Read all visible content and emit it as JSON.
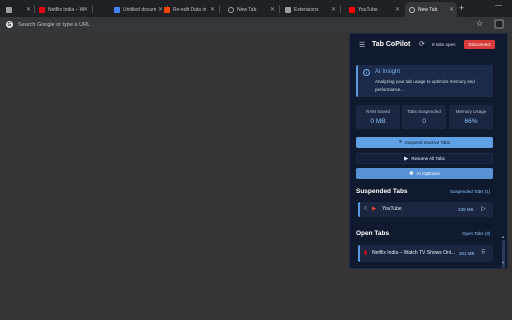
{
  "browser": {
    "tabs": [
      {
        "title": "",
        "favicon": "generic-icon",
        "active": false
      },
      {
        "title": "Netflix India – W",
        "favicon": "netflix-icon",
        "active": false
      },
      {
        "title": "Untitled docum",
        "favicon": "docs-icon",
        "active": false
      },
      {
        "title": "Re-edit Data in",
        "favicon": "reddit-icon",
        "active": false
      },
      {
        "title": "New Tab",
        "favicon": "chrome-icon",
        "active": false
      },
      {
        "title": "Extensions",
        "favicon": "puzzle-icon",
        "active": false
      },
      {
        "title": "YouTube",
        "favicon": "youtube-icon",
        "active": false
      },
      {
        "title": "New Tab",
        "favicon": "chrome-icon",
        "active": true
      }
    ],
    "omnibox_placeholder": "Search Google or type a URL"
  },
  "popup": {
    "title": "Tab CoPilot",
    "tabs_open": "8 tabs open",
    "disconnect_label": "Disconnect",
    "insight": {
      "title": "AI Insight",
      "text": "Analyzing your tab usage to optimize memory and performance..."
    },
    "stats": [
      {
        "label": "RAM Saved",
        "value": "0 MB"
      },
      {
        "label": "Tabs Suspended",
        "value": "0"
      },
      {
        "label": "Memory Usage",
        "value": "66%"
      }
    ],
    "actions": {
      "suspend": "Suspend Inactive Tabs",
      "resume": "Resume All Tabs",
      "optimize": "AI Optimize"
    },
    "suspended_section": {
      "title": "Suspended Tabs",
      "link": "Suspended Tabs (1)",
      "items": [
        {
          "name": "YouTube",
          "size": "339 MB"
        }
      ]
    },
    "open_section": {
      "title": "Open Tabs",
      "link": "Open Tabs (8)",
      "items": [
        {
          "name": "Netflix India – Watch TV Shows Onl...",
          "size": "301 MB"
        }
      ]
    }
  },
  "colors": {
    "popup_bg": "#0f1a2e",
    "accent": "#5fa1e4",
    "danger": "#d93a3a"
  }
}
